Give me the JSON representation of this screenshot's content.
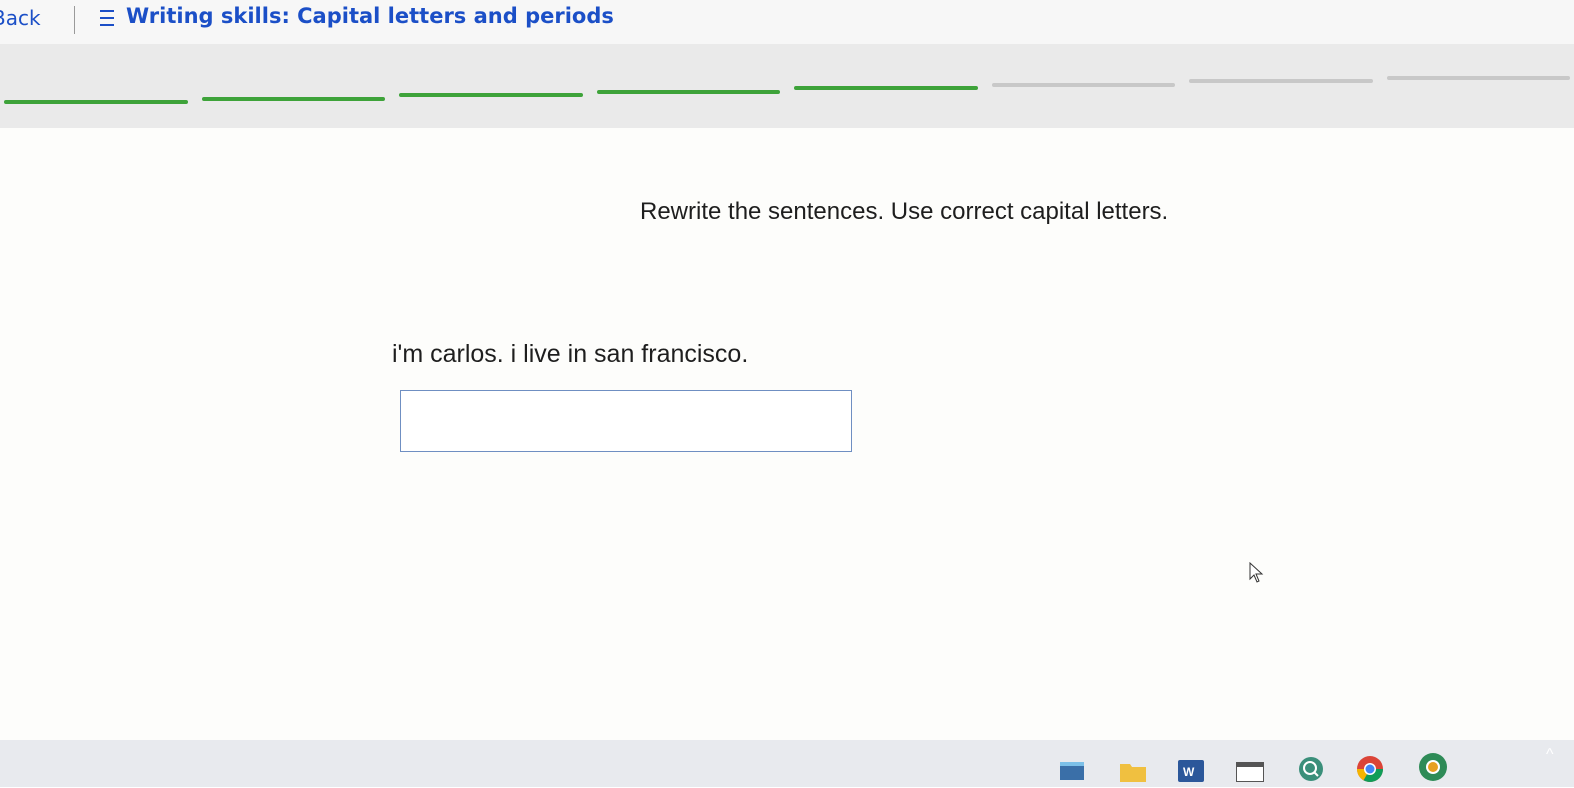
{
  "header": {
    "back_label": "Back",
    "menu_icon": "menu-icon",
    "title": "Writing skills: Capital letters and periods"
  },
  "progress": {
    "total_segments": 8,
    "completed_segments": 5,
    "completed_color": "#3ea33a",
    "pending_color": "#c8c8c8"
  },
  "question": {
    "instruction": "Rewrite the sentences. Use correct capital letters.",
    "sentence": "i'm carlos. i live in san francisco.",
    "answer_value": ""
  },
  "colors": {
    "accent": "#1b4fc7",
    "input_border": "#6f8fc2"
  },
  "taskbar": {
    "icons": [
      "app-icon",
      "folder-icon",
      "word-icon",
      "window-icon",
      "search-icon",
      "chrome-icon",
      "chrome-canary-icon"
    ],
    "tray_caret": "^"
  }
}
